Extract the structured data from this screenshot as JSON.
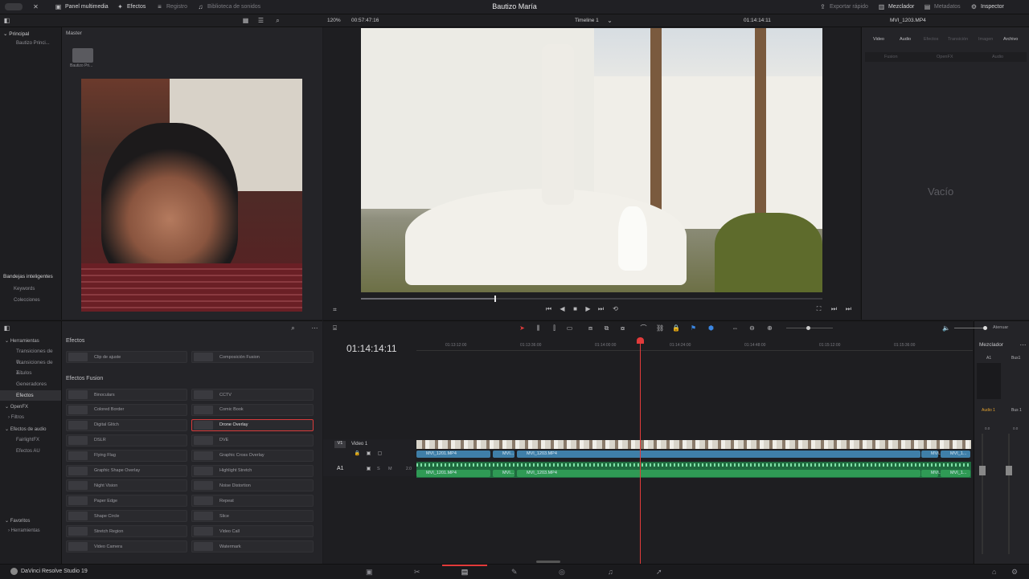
{
  "topbar": {
    "media_pool": "Panel multimedia",
    "effects": "Efectos",
    "index": "Registro",
    "sound_library": "Biblioteca de sonidos",
    "project_title": "Bautizo María",
    "quick_export": "Exportar rápido",
    "mixer": "Mezclador",
    "metadata": "Metadatos",
    "inspector": "Inspector"
  },
  "viewer_bar": {
    "zoom": "120%",
    "duration": "00:57:47:16",
    "timeline_name": "Timeline 1",
    "timecode": "01:14:14:11",
    "clip_name": "MVI_1203.MP4"
  },
  "media_pool": {
    "root": "Principal",
    "bins": [
      "Bautizo Princi..."
    ],
    "master_label": "Master",
    "folder_name": "Bautizo Pri...",
    "smart_bins": "Bandejas inteligentes",
    "smart_items": [
      "Keywords",
      "Colecciones"
    ]
  },
  "inspector": {
    "tabs": [
      "Video",
      "Audio",
      "Efectos",
      "Transición",
      "Imagen",
      "Archivo"
    ],
    "subtabs": [
      "Fusion",
      "OpenFX",
      "Audio"
    ],
    "empty": "Vacío"
  },
  "effects_tree": {
    "header": "Herramientas",
    "items": [
      "Transiciones de vi...",
      "Transiciones de a...",
      "Títulos",
      "Generadores",
      "Efectos"
    ],
    "openfx": "OpenFX",
    "openfx_items": [
      "Filtros"
    ],
    "audio_fx": "Efectos de audio",
    "audio_items": [
      "FairlightFX",
      "Efectos AU"
    ],
    "favorites": "Favoritos",
    "fav_items": [
      "Herramientas"
    ]
  },
  "effects_panel": {
    "section1": "Efectos",
    "section1_items": [
      "Clip de ajuste",
      "Composición Fusion"
    ],
    "section2": "Efectos Fusion",
    "fusion_left": [
      "Binoculars",
      "Colored Border",
      "Digital Glitch",
      "DSLR",
      "Flying Flag",
      "Graphic Shape Overlay",
      "Night Vision",
      "Paper Edge",
      "Shape Circle",
      "Stretch Region",
      "Video Camera"
    ],
    "fusion_right": [
      "CCTV",
      "Comic Book",
      "Drone Overlay",
      "DVE",
      "Graphic Cross Overlay",
      "Highlight Stretch",
      "Noise Distortion",
      "Repeat",
      "Slice",
      "Video Call",
      "Watermark"
    ]
  },
  "timeline": {
    "timecode": "01:14:14:11",
    "ruler": [
      "01:13:12:00",
      "01:13:36:00",
      "01:14:00:00",
      "01:14:24:00",
      "01:14:48:00",
      "01:15:12:00",
      "01:15:36:00"
    ],
    "v1_label": "V1",
    "v1_name": "Video 1",
    "a1_label": "A1",
    "a1_level": "2.0",
    "clips_video": [
      "MVI_1201.MP4",
      "MVI...",
      "MVI_1203.MP4",
      "MVI...",
      "MVI_1..."
    ],
    "clips_audio": [
      "MVI_1201.MP4",
      "MVI...",
      "MVI_1203.MP4",
      "MVI...",
      "MVI_1..."
    ],
    "attenuate": "Atenuar"
  },
  "mixer": {
    "title": "Mezclador",
    "ch1": "A1",
    "ch2": "Bus1",
    "audio1": "Audio 1",
    "bus1": "Bus 1",
    "val1": "0.0",
    "val2": "0.0"
  },
  "footer": {
    "app": "DaVinci Resolve Studio 19"
  },
  "colors": {
    "accent_red": "#d83b3b",
    "video_clip": "#3f7fa8",
    "audio_clip": "#2f9a55",
    "playhead": "#e23b3b"
  },
  "playback": {
    "progress": 0.29
  }
}
